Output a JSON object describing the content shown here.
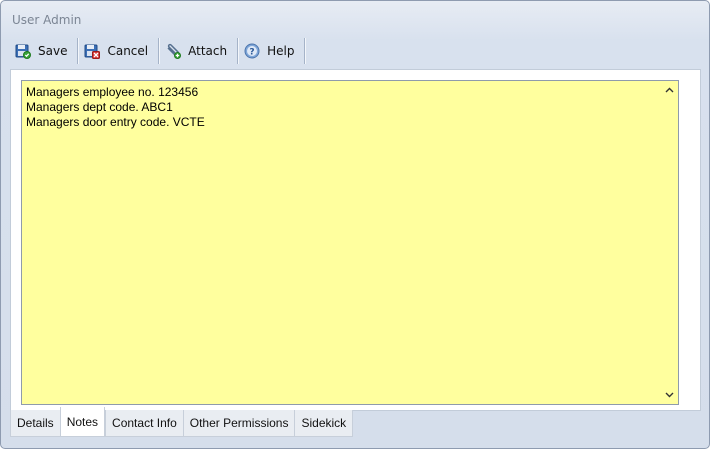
{
  "window": {
    "title": "User Admin"
  },
  "toolbar": {
    "buttons": [
      {
        "label": "Save",
        "icon": "save-icon"
      },
      {
        "label": "Cancel",
        "icon": "cancel-icon"
      },
      {
        "label": "Attach",
        "icon": "attach-icon"
      },
      {
        "label": "Help",
        "icon": "help-icon"
      }
    ]
  },
  "notes": {
    "lines": [
      "Managers employee no. 123456",
      "Managers dept code. ABC1",
      "Managers door entry code. VCTE"
    ],
    "background": "#ffff9e"
  },
  "tabs": [
    {
      "label": "Details"
    },
    {
      "label": "Notes",
      "active": true
    },
    {
      "label": "Contact Info"
    },
    {
      "label": "Other Permissions"
    },
    {
      "label": "Sidekick"
    }
  ]
}
